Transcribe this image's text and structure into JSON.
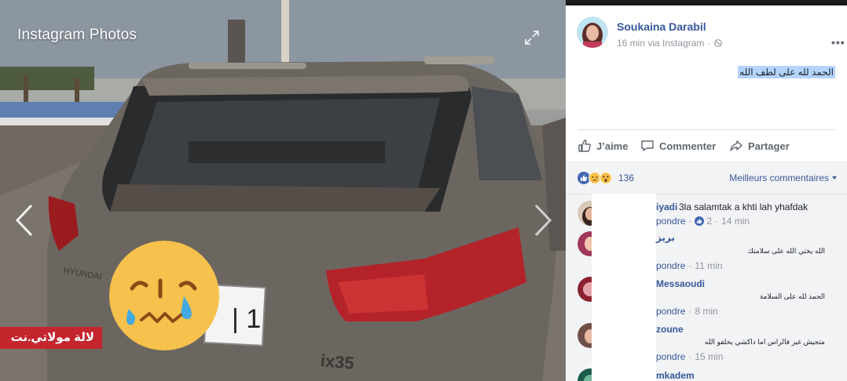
{
  "viewer": {
    "title": "Instagram Photos",
    "watermark_text": "لالة مولاتي.نت",
    "icons": {
      "expand": "expand-icon",
      "prev": "chevron-left-icon",
      "next": "chevron-right-icon"
    },
    "sticker": "crying-face-emoji"
  },
  "post": {
    "author": "Soukaina Darabil",
    "time": "16 min",
    "via": "via Instagram",
    "separator": "·",
    "text": "الحمد لله على لطف الله",
    "actions": {
      "like": "J’aime",
      "comment": "Commenter",
      "share": "Partager"
    },
    "reactions_count": "136",
    "sort_label": "Meilleurs commentaires"
  },
  "comments": [
    {
      "name": "iyadi",
      "text": "3la salamtak a khti lah yhafdak",
      "reply": "pondre",
      "likes": "2",
      "time": "14 min"
    },
    {
      "name": "بريز",
      "text": "الله يختي الله على سلامتك",
      "reply": "pondre",
      "time": "11 min"
    },
    {
      "name": "Messaoudi",
      "text": "الحمد لله على السلامة",
      "reply": "pondre",
      "time": "8 min"
    },
    {
      "name": "zoune",
      "text": "متجيش غير فالراس اما داكشي يخلفو الله",
      "reply": "pondre",
      "time": "15 min"
    },
    {
      "name": "mkadem"
    }
  ],
  "colors": {
    "link": "#365899",
    "meta": "#90949c",
    "watermark": "#c4262e",
    "like_blue": "#4267b2",
    "comments_bg": "#f2f3f5"
  }
}
